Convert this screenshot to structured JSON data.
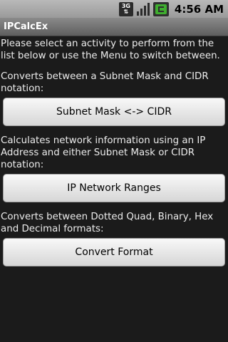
{
  "status_bar": {
    "network_label_top": "3G",
    "time": "4:56 AM",
    "icons": [
      "3g-icon",
      "signal-icon",
      "battery-icon"
    ]
  },
  "app": {
    "title": "IPCalcEx"
  },
  "main": {
    "intro": "Please select an activity to perform from the list below or use the Menu to switch between.",
    "sections": [
      {
        "description": "Converts between a Subnet Mask and CIDR notation:",
        "button_label": "Subnet Mask <-> CIDR"
      },
      {
        "description": "Calculates network information using an IP Address and either Subnet Mask or CIDR notation:",
        "button_label": "IP Network Ranges"
      },
      {
        "description": "Converts between Dotted Quad, Binary, Hex and Decimal formats:",
        "button_label": "Convert Format"
      }
    ]
  }
}
